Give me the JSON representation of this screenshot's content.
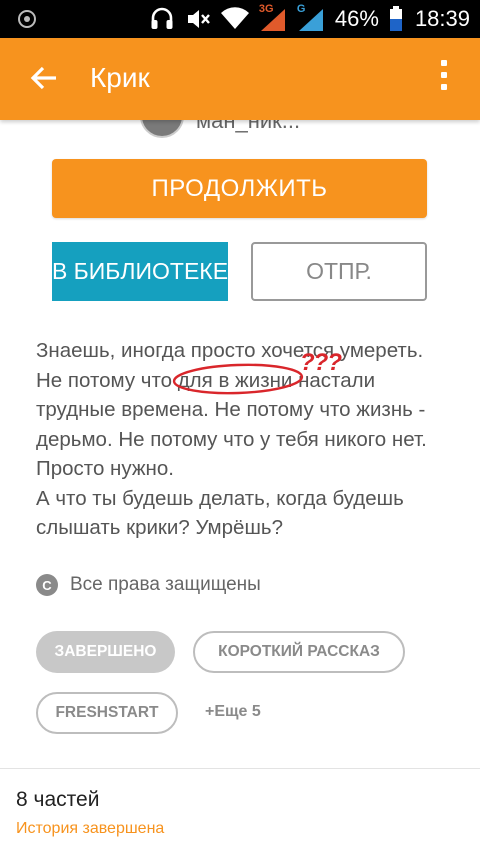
{
  "status_bar": {
    "network_3g": "3G",
    "network_g": "G",
    "battery": "46%",
    "time": "18:39",
    "icons": [
      "notification-icon",
      "headset-icon",
      "mute-icon",
      "wifi-icon",
      "signal-3g-icon",
      "signal-g-icon",
      "battery-icon"
    ]
  },
  "app_bar": {
    "title": "Крик",
    "back_icon": "arrow-left-icon",
    "menu_icon": "more-vertical-icon"
  },
  "author": {
    "name": "ман_ник..."
  },
  "actions": {
    "continue_label": "ПРОДОЛЖИТЬ",
    "library_label": "В БИБЛИОТЕКЕ",
    "send_label": "ОТПР."
  },
  "description": {
    "line1_a": "Знаешь, иногда просто хочется умереть.",
    "line2_a": "Не потому что ",
    "line2_b": "для в жизни",
    "line2_c": " настали",
    "line3": "трудные времена. Не потому что жизнь -",
    "line4": "дерьмо. Не потому что у тебя никого нет.",
    "line5": "Просто нужно.",
    "line6": "А что ты будешь делать, когда будешь",
    "line7": "слышать крики? Умрёшь?",
    "annotation_marks": "???"
  },
  "copyright": {
    "icon": "copyright-icon",
    "symbol": "C",
    "text": "Все права защищены"
  },
  "tags": {
    "completed": "ЗАВЕРШЕНО",
    "short_story": "КОРОТКИЙ РАССКАЗ",
    "freshstart": "FRESHSTART",
    "more": "+Еще 5"
  },
  "parts": {
    "count": "8 частей",
    "status": "История завершена"
  },
  "colors": {
    "accent": "#f7931e",
    "library": "#15a0bf",
    "annotation": "#d9262b"
  }
}
